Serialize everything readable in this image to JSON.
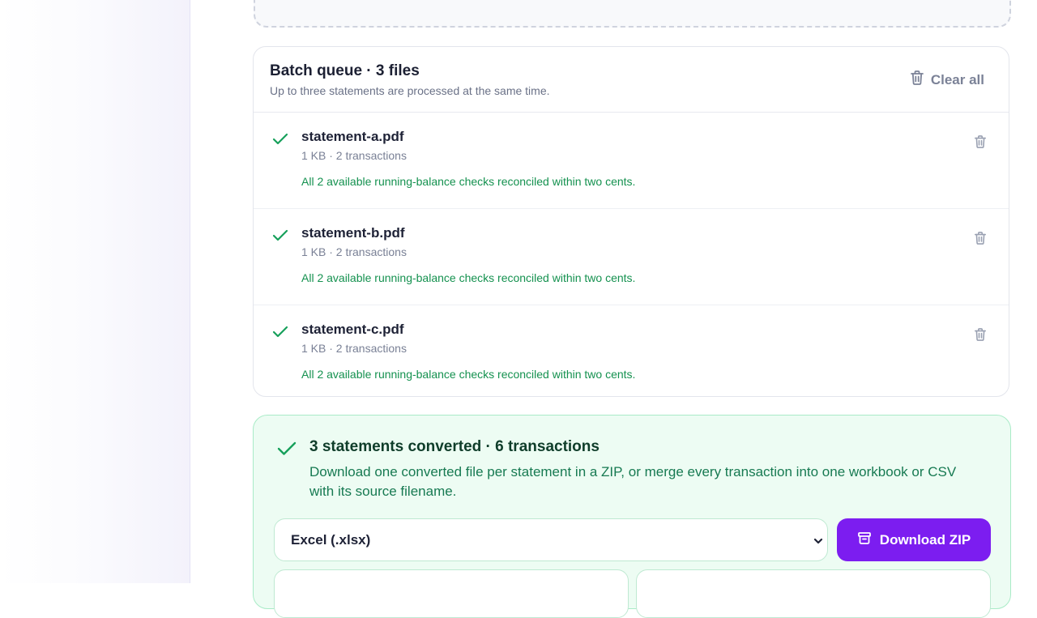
{
  "queue": {
    "title": "Batch queue · 3 files",
    "subtitle": "Up to three statements are processed at the same time.",
    "clear_all_label": "Clear all",
    "clear_icon": "trash-icon",
    "files": [
      {
        "name": "statement-a.pdf",
        "meta": "1 KB · 2 transactions",
        "status": "All 2 available running-balance checks reconciled within two cents.",
        "status_icon": "check-icon"
      },
      {
        "name": "statement-b.pdf",
        "meta": "1 KB · 2 transactions",
        "status": "All 2 available running-balance checks reconciled within two cents.",
        "status_icon": "check-icon"
      },
      {
        "name": "statement-c.pdf",
        "meta": "1 KB · 2 transactions",
        "status": "All 2 available running-balance checks reconciled within two cents.",
        "status_icon": "check-icon"
      }
    ]
  },
  "result": {
    "title": "3 statements converted · 6 transactions",
    "description": "Download one converted file per statement in a ZIP, or merge every transaction into one workbook or CSV with its source filename.",
    "format_selected": "Excel (.xlsx)",
    "download_label": "Download ZIP",
    "download_icon": "archive-icon"
  },
  "colors": {
    "accent": "#7c1df0",
    "success": "#14914f",
    "success_bg": "#edfcf3",
    "muted": "#7a8196"
  }
}
